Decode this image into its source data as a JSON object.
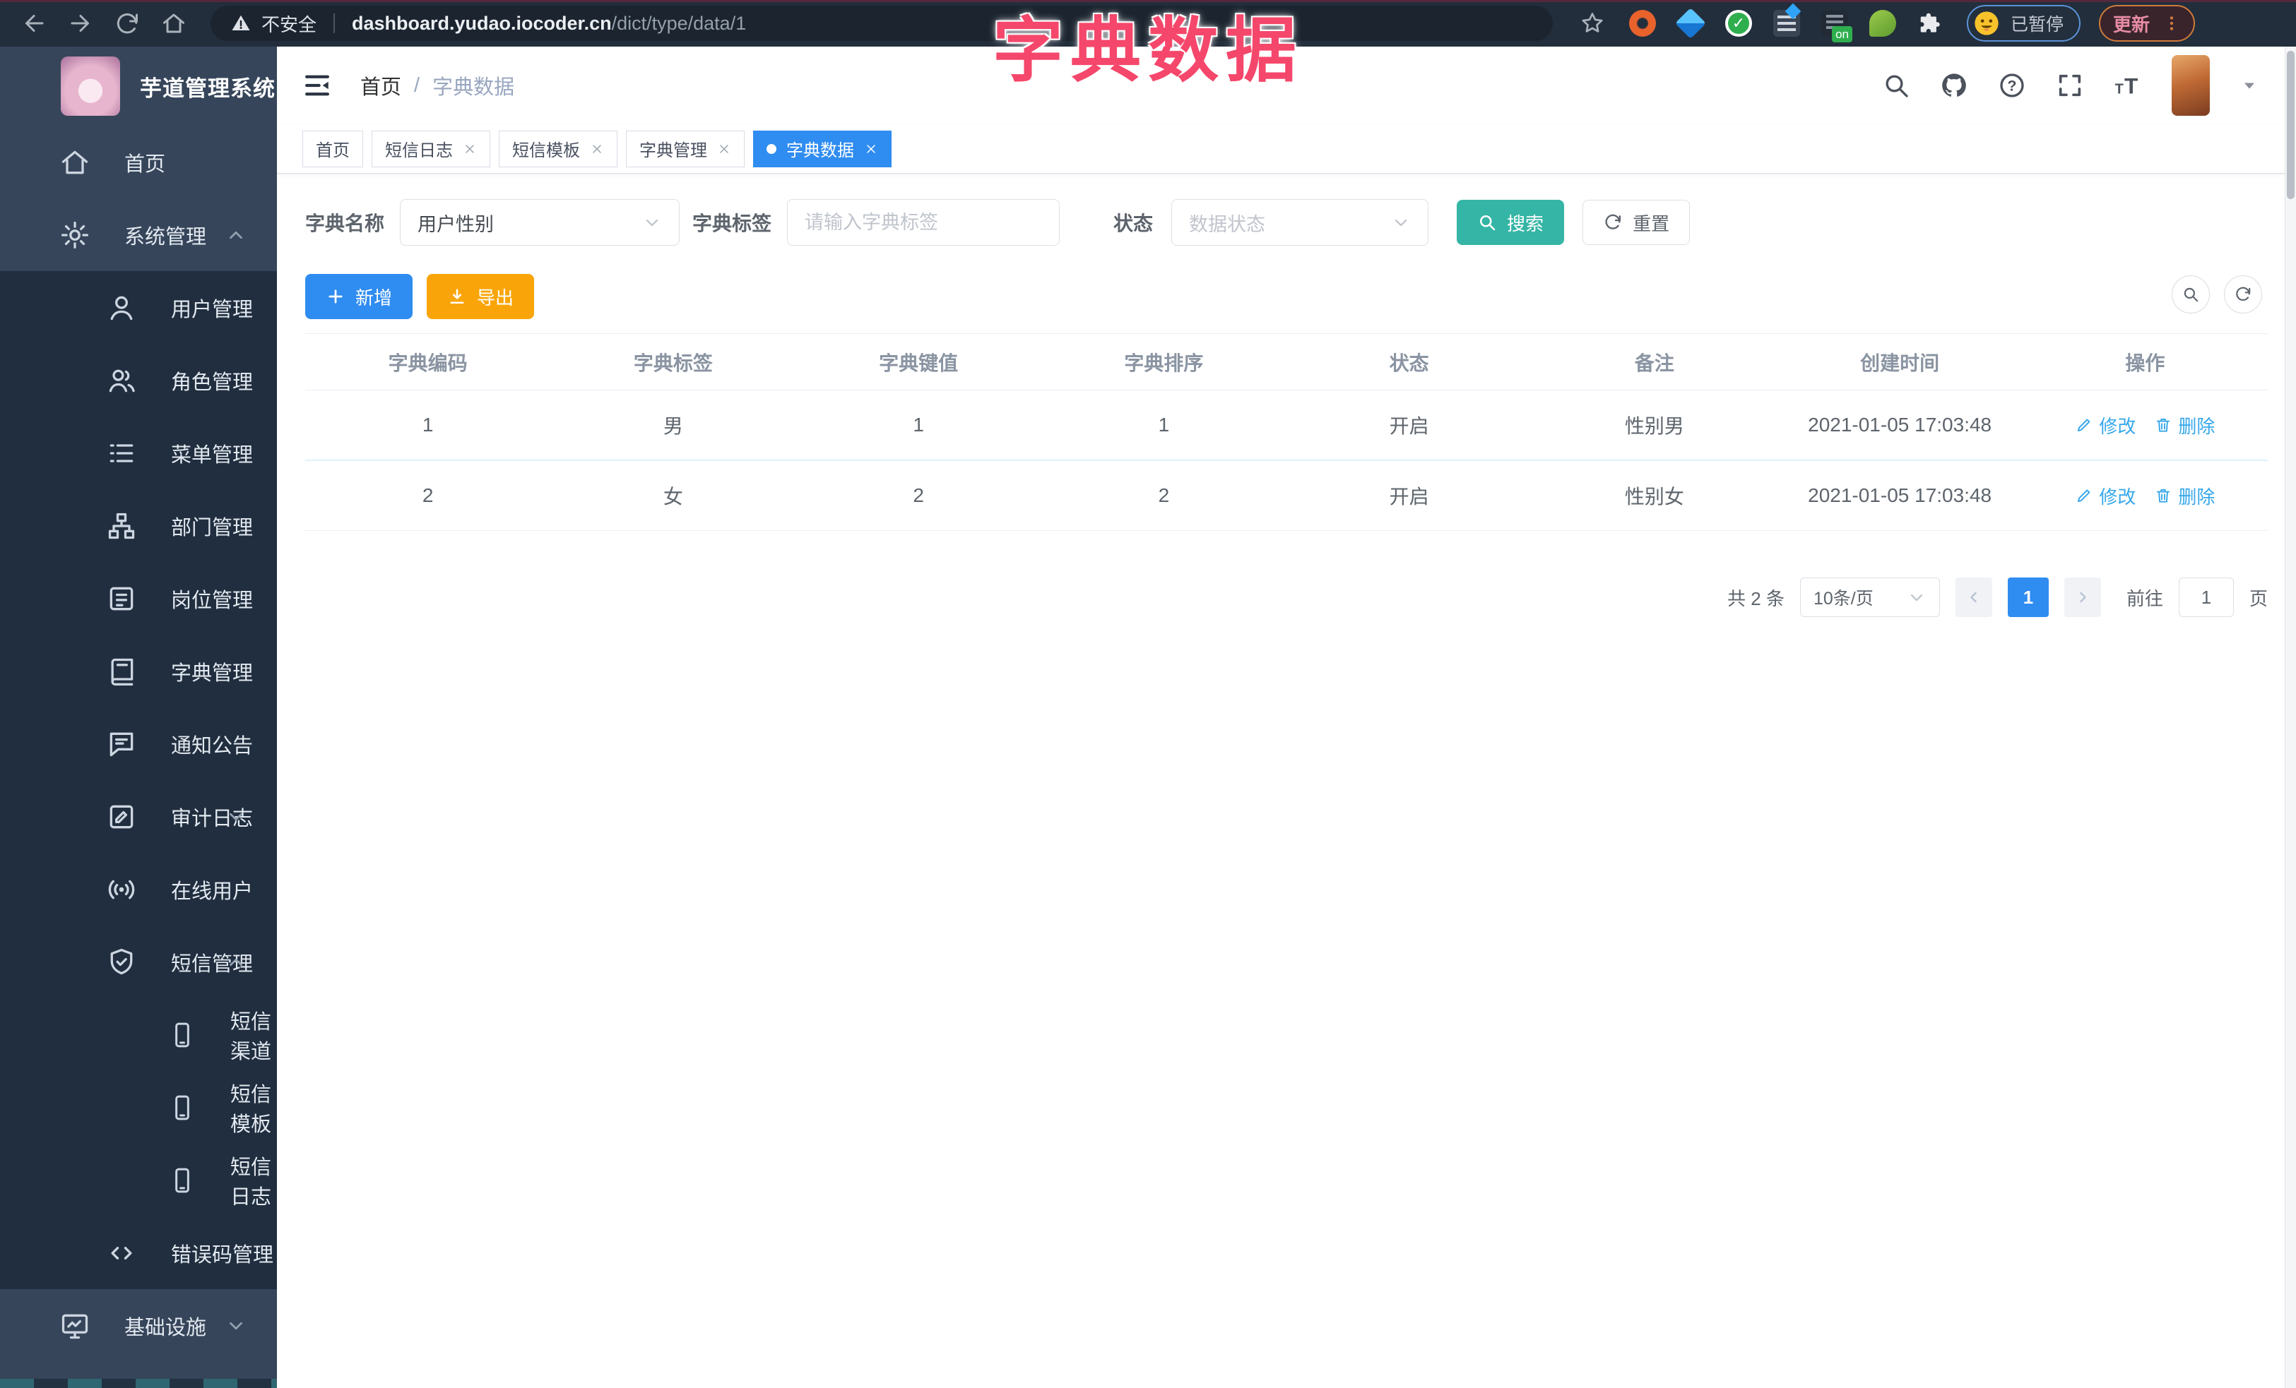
{
  "overlay_title": "字典数据",
  "browser": {
    "security": "不安全",
    "url_host": "dashboard.yudao.iocoder.cn",
    "url_path": "/dict/type/data/1",
    "profile_chip": "已暂停",
    "update_button": "更新"
  },
  "sidebar": {
    "app_title": "芋道管理系统",
    "items": [
      {
        "label": "首页",
        "icon": "home",
        "level": 1,
        "chevron": ""
      },
      {
        "label": "系统管理",
        "icon": "gear",
        "level": 1,
        "chevron": "up"
      },
      {
        "label": "用户管理",
        "icon": "user",
        "level": 2,
        "chevron": ""
      },
      {
        "label": "角色管理",
        "icon": "users",
        "level": 2,
        "chevron": ""
      },
      {
        "label": "菜单管理",
        "icon": "list",
        "level": 2,
        "chevron": ""
      },
      {
        "label": "部门管理",
        "icon": "tree",
        "level": 2,
        "chevron": ""
      },
      {
        "label": "岗位管理",
        "icon": "badge",
        "level": 2,
        "chevron": ""
      },
      {
        "label": "字典管理",
        "icon": "book",
        "level": 2,
        "chevron": ""
      },
      {
        "label": "通知公告",
        "icon": "message",
        "level": 2,
        "chevron": ""
      },
      {
        "label": "审计日志",
        "icon": "log",
        "level": 2,
        "chevron": "down"
      },
      {
        "label": "在线用户",
        "icon": "online",
        "level": 2,
        "chevron": ""
      },
      {
        "label": "短信管理",
        "icon": "shield",
        "level": 2,
        "chevron": "up"
      },
      {
        "label": "短信渠道",
        "icon": "phone",
        "level": 3,
        "chevron": ""
      },
      {
        "label": "短信模板",
        "icon": "phone",
        "level": 3,
        "chevron": ""
      },
      {
        "label": "短信日志",
        "icon": "phone",
        "level": 3,
        "chevron": ""
      },
      {
        "label": "错误码管理",
        "icon": "code",
        "level": 2,
        "chevron": ""
      },
      {
        "label": "基础设施",
        "icon": "monitor",
        "level": 1,
        "chevron": "down"
      }
    ]
  },
  "header": {
    "breadcrumb": [
      "首页",
      "字典数据"
    ],
    "breadcrumb_sep": "/"
  },
  "tabs": [
    {
      "label": "首页",
      "closable": false,
      "active": false
    },
    {
      "label": "短信日志",
      "closable": true,
      "active": false
    },
    {
      "label": "短信模板",
      "closable": true,
      "active": false
    },
    {
      "label": "字典管理",
      "closable": true,
      "active": false
    },
    {
      "label": "字典数据",
      "closable": true,
      "active": true
    }
  ],
  "filters": {
    "dict_name_label": "字典名称",
    "dict_name_value": "用户性别",
    "dict_label_label": "字典标签",
    "dict_label_placeholder": "请输入字典标签",
    "status_label": "状态",
    "status_placeholder": "数据状态",
    "search_button": "搜索",
    "reset_button": "重置"
  },
  "toolbar": {
    "add_button": "新增",
    "export_button": "导出"
  },
  "table": {
    "columns": [
      "字典编码",
      "字典标签",
      "字典键值",
      "字典排序",
      "状态",
      "备注",
      "创建时间",
      "操作"
    ],
    "rows": [
      [
        "1",
        "男",
        "1",
        "1",
        "开启",
        "性别男",
        "2021-01-05 17:03:48"
      ],
      [
        "2",
        "女",
        "2",
        "2",
        "开启",
        "性别女",
        "2021-01-05 17:03:48"
      ]
    ],
    "actions": {
      "edit": "修改",
      "delete": "删除"
    }
  },
  "pagination": {
    "total": "共 2 条",
    "page_size": "10条/页",
    "current_page": "1",
    "goto_label": "前往",
    "goto_value": "1",
    "page_unit": "页"
  },
  "colors": {
    "primary_blue": "#2f8cf0",
    "teal": "#35b5a5",
    "orange": "#f9a50a",
    "link_cyan": "#37a8ea",
    "title_pink": "#f5476b",
    "sidebar_bg": "#36455a",
    "submenu_bg": "#202e3f",
    "chrome_bg": "#232e3c"
  }
}
